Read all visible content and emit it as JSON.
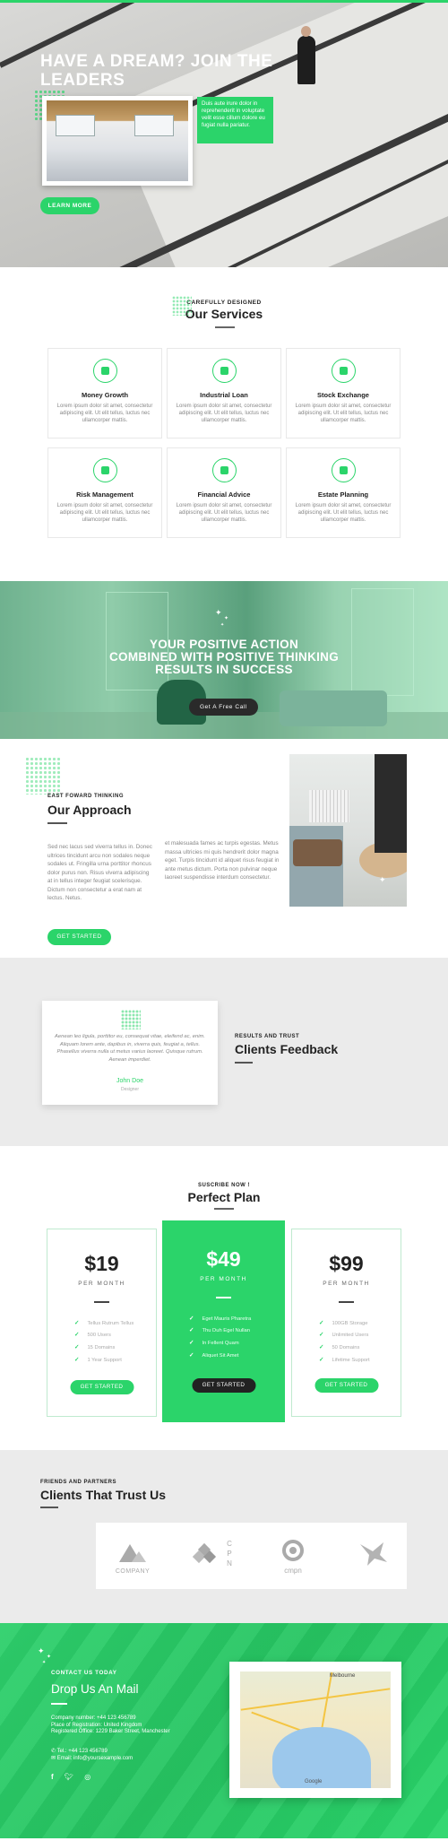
{
  "hero": {
    "title": "HAVE A DREAM? JOIN THE LEADERS",
    "note": "Duis aute irure dolor in reprehenderit in voluptate velit esse cillum dolore eu fugiat nulla pariatur.",
    "button": "LEARN MORE"
  },
  "services": {
    "kicker": "CAREFULLY DESIGNED",
    "title": "Our Services",
    "items": [
      {
        "icon": "money-growth-icon",
        "title": "Money Growth",
        "desc": "Lorem ipsum dolor sit amet, consectetur adipiscing elit. Ut elit tellus, luctus nec ullamcorper mattis."
      },
      {
        "icon": "industrial-loan-icon",
        "title": "Industrial Loan",
        "desc": "Lorem ipsum dolor sit amet, consectetur adipiscing elit. Ut elit tellus, luctus nec ullamcorper mattis."
      },
      {
        "icon": "stock-exchange-icon",
        "title": "Stock Exchange",
        "desc": "Lorem ipsum dolor sit amet, consectetur adipiscing elit. Ut elit tellus, luctus nec ullamcorper mattis."
      },
      {
        "icon": "risk-management-icon",
        "title": "Risk Management",
        "desc": "Lorem ipsum dolor sit amet, consectetur adipiscing elit. Ut elit tellus, luctus nec ullamcorper mattis."
      },
      {
        "icon": "financial-advice-icon",
        "title": "Financial Advice",
        "desc": "Lorem ipsum dolor sit amet, consectetur adipiscing elit. Ut elit tellus, luctus nec ullamcorper mattis."
      },
      {
        "icon": "estate-planning-icon",
        "title": "Estate Planning",
        "desc": "Lorem ipsum dolor sit amet, consectetur adipiscing elit. Ut elit tellus, luctus nec ullamcorper mattis."
      }
    ]
  },
  "banner": {
    "line1": "YOUR POSITIVE ACTION",
    "line2": "COMBINED WITH POSITIVE THINKING",
    "line3": "RESULTS IN SUCCESS",
    "button": "Get A Free Call"
  },
  "approach": {
    "kicker": "EAST FOWARD THINKING",
    "title": "Our Approach",
    "col1": "Sed nec lacus sed viverra tellus in. Donec ultrices tincidunt arcu non sodales neque sodales ut. Fringilla urna porttitor rhoncus dolor purus non. Risus viverra adipiscing at in tellus integer feugiat scelerisque. Dictum non consectetur a erat nam at lectus. Netus.",
    "col2": "et malesuada fames ac turpis egestas. Metus massa ultricies mi quis hendrerit dolor magna eget. Turpis tincidunt id aliquet risus feugiat in ante metus dictum. Porta non pulvinar neque laoreet suspendisse interdum consectetur.",
    "button": "GET STARTED"
  },
  "feedback": {
    "quote": "Aenean leo ligula, porttitor eu, consequat vitae, eleifend ac, enim. Aliquam lorem ante, dapibus in, viverra quis, feugiat a, tellus. Phasellus viverra nulla ut metus varius laoreet. Quisque rutrum. Aenean imperdiet.",
    "name": "John Doe",
    "role": "Designer",
    "kicker": "RESULTS AND TRUST",
    "title": "Clients Feedback"
  },
  "pricing": {
    "kicker": "SUSCRIBE NOW !",
    "title": "Perfect Plan",
    "plans": [
      {
        "price": "$19",
        "period": "PER MONTH",
        "features": [
          "Tellus Rutrum Tellus",
          "500 Users",
          "15 Domains",
          "1 Year Support"
        ],
        "button": "GET STARTED"
      },
      {
        "price": "$49",
        "period": "PER MONTH",
        "features": [
          "Eget Mauris Pharetra",
          "Thu Duh Egel Nullan",
          "In Fellent Quam",
          "Aliquet Sit Amet"
        ],
        "button": "GET STARTED"
      },
      {
        "price": "$99",
        "period": "PER MONTH",
        "features": [
          "100GB Storage",
          "Unlimited Users",
          "50 Domains",
          "Lifetime Support"
        ],
        "button": "GET STARTED"
      }
    ]
  },
  "clients": {
    "kicker": "FRIENDS AND PARTNERS",
    "title": "Clients That Trust Us",
    "logos": [
      "COMPANY",
      "CPN",
      "cmpn",
      ""
    ]
  },
  "contact": {
    "kicker": "CONTACT US TODAY",
    "title": "Drop Us An Mail",
    "company_number": "Company number: +44 123 456789",
    "place": "Place of Registration: United Kingdom",
    "office": "Registered Office: 1229 Baker Street, Manchester",
    "tel": "Tel.: +44 123 456789",
    "email": "Email: info@yoursexample.com",
    "map_labels": [
      "Melbourne",
      "Google"
    ]
  },
  "colors": {
    "accent": "#2bd46a",
    "dark": "#222222",
    "light_bg": "#ebebeb"
  }
}
